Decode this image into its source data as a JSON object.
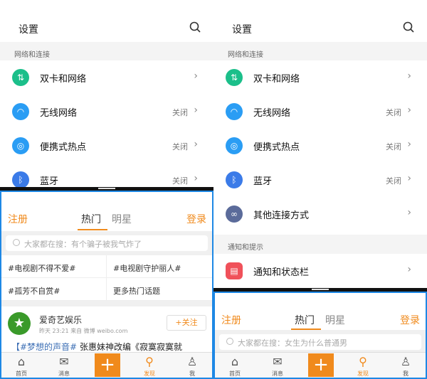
{
  "settings": {
    "title": "设置",
    "section_network": "网络和连接",
    "section_notify": "通知和提示",
    "items": [
      {
        "label": "双卡和网络",
        "status": "",
        "color": "#1bbf8a",
        "icon": "⇅"
      },
      {
        "label": "无线网络",
        "status": "关闭",
        "color": "#2a9df4",
        "icon": "◠"
      },
      {
        "label": "便携式热点",
        "status": "关闭",
        "color": "#2a9df4",
        "icon": "◎"
      },
      {
        "label": "蓝牙",
        "status": "关闭",
        "color": "#3b7be8",
        "icon": "ᛒ"
      },
      {
        "label": "其他连接方式",
        "status": "",
        "color": "#5b6b9a",
        "icon": "∞"
      },
      {
        "label": "通知和状态栏",
        "status": "",
        "color": "#f0515a",
        "icon": "▤"
      }
    ]
  },
  "weibo": {
    "register": "注册",
    "login": "登录",
    "tab_hot": "热门",
    "tab_star": "明星",
    "search_left": "大家都在搜：有个骗子被我气炸了",
    "search_right": "大家都在搜：女生为什么普通男",
    "topics": [
      "#电视剧不得不爱#",
      "#电视剧守护丽人#",
      "#孤芳不自赏#",
      "更多热门话题"
    ],
    "post": {
      "name": "爱奇艺娱乐",
      "meta": "昨天 23:21  来自 微博 weibo.com",
      "follow": "+关注",
      "hashtag": "【#梦想的声音#",
      "text": " 张惠妹神改编《寂寞寂寞就"
    },
    "nav": [
      "首页",
      "消息",
      "发现",
      "我"
    ]
  }
}
